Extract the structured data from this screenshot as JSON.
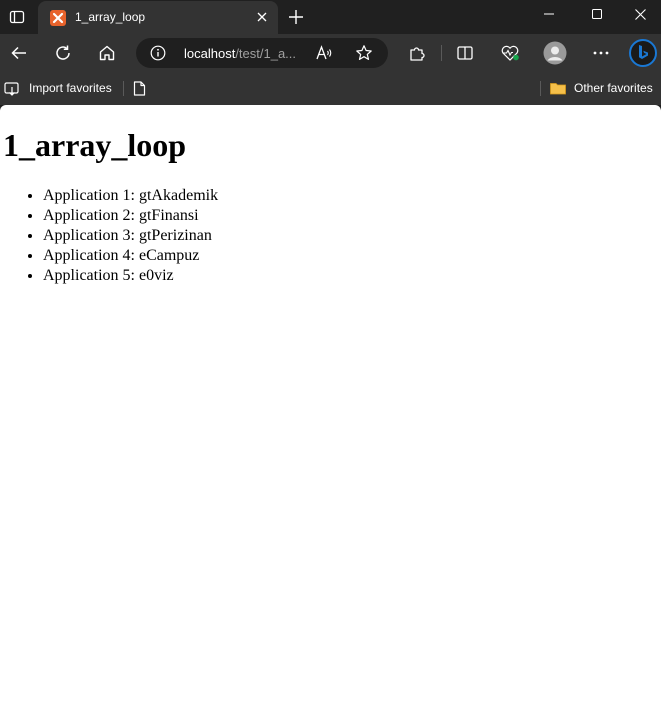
{
  "browser": {
    "tab": {
      "title": "1_array_loop",
      "favicon": "xampp-favicon-icon"
    },
    "address": {
      "host": "localhost",
      "path": "/test/1_a..."
    },
    "favorites": {
      "import_label": "Import favorites",
      "other_label": "Other favorites"
    },
    "colors": {
      "frame": "#202020",
      "toolbar": "#333333",
      "address_bg": "#1f1f1f",
      "favicon": "#e8632c",
      "bing": "#1a78d4"
    }
  },
  "page": {
    "heading": "1_array_loop",
    "items": [
      "Application 1: gtAkademik",
      "Application 2: gtFinansi",
      "Application 3: gtPerizinan",
      "Application 4: eCampuz",
      "Application 5: e0viz"
    ]
  }
}
